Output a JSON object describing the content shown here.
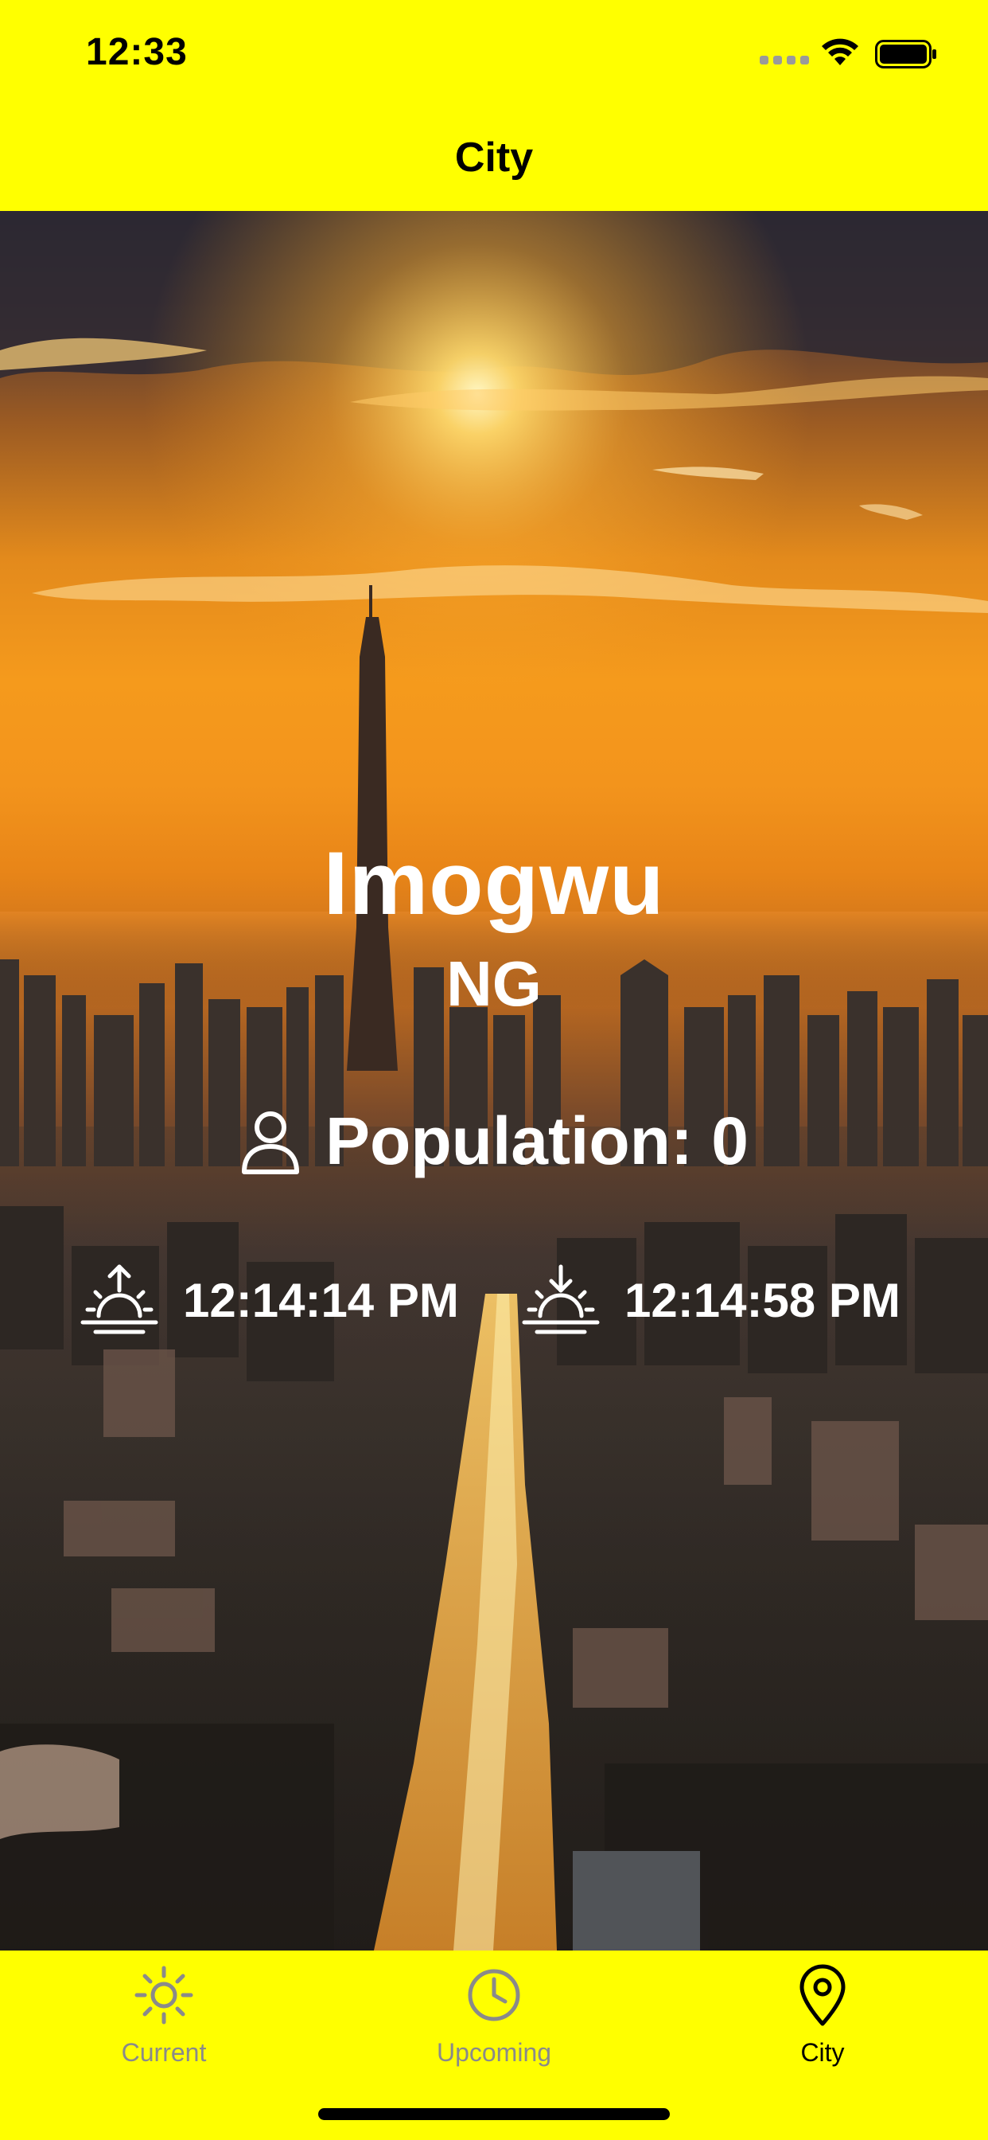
{
  "status_bar": {
    "time": "12:33"
  },
  "nav": {
    "title": "City"
  },
  "city": {
    "name": "Imogwu",
    "country": "NG",
    "population_text": "Population: 0",
    "sunrise": "12:14:14 PM",
    "sunset": "12:14:58 PM"
  },
  "icons": {
    "population": "person-icon",
    "sunrise": "sunrise-icon",
    "sunset": "sunset-icon"
  },
  "tab_bar": {
    "tabs": [
      {
        "label": "Current",
        "icon": "sun-icon",
        "selected": false
      },
      {
        "label": "Upcoming",
        "icon": "clock-icon",
        "selected": false
      },
      {
        "label": "City",
        "icon": "map-pin-icon",
        "selected": true
      }
    ]
  },
  "colors": {
    "accent": "#FFFF00",
    "tab_inactive": "#8A8A8A",
    "tab_active": "#000000",
    "text_on_image": "#FFFFFF"
  }
}
